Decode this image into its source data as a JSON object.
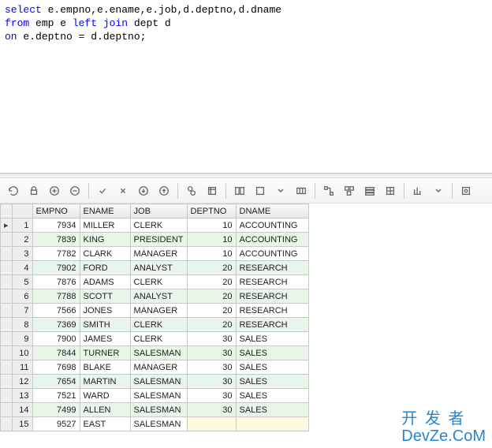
{
  "sql": {
    "line1": {
      "kw1": "select",
      "rest1": " e.empno,e.ename,e.job,d.deptno,d.dname"
    },
    "line2": {
      "kw1": "from",
      "rest1": " emp e ",
      "kw2": "left join",
      "rest2": " dept d"
    },
    "line3": {
      "kw1": "on",
      "rest1": " e.deptno = d.deptno;"
    }
  },
  "toolbar": {
    "icons": [
      "refresh",
      "lock",
      "add",
      "remove",
      "commit",
      "rollback",
      "down-all",
      "up-all",
      "find",
      "filter",
      "group",
      "export-single",
      "filter-rows",
      "fit",
      "relations",
      "diagram",
      "tree",
      "pivot",
      "chart",
      "settings"
    ]
  },
  "grid": {
    "columns": [
      "EMPNO",
      "ENAME",
      "JOB",
      "DEPTNO",
      "DNAME"
    ],
    "rows": [
      {
        "empno": 7934,
        "ename": "MILLER",
        "job": "CLERK",
        "deptno": 10,
        "dname": "ACCOUNTING"
      },
      {
        "empno": 7839,
        "ename": "KING",
        "job": "PRESIDENT",
        "deptno": 10,
        "dname": "ACCOUNTING"
      },
      {
        "empno": 7782,
        "ename": "CLARK",
        "job": "MANAGER",
        "deptno": 10,
        "dname": "ACCOUNTING"
      },
      {
        "empno": 7902,
        "ename": "FORD",
        "job": "ANALYST",
        "deptno": 20,
        "dname": "RESEARCH"
      },
      {
        "empno": 7876,
        "ename": "ADAMS",
        "job": "CLERK",
        "deptno": 20,
        "dname": "RESEARCH"
      },
      {
        "empno": 7788,
        "ename": "SCOTT",
        "job": "ANALYST",
        "deptno": 20,
        "dname": "RESEARCH"
      },
      {
        "empno": 7566,
        "ename": "JONES",
        "job": "MANAGER",
        "deptno": 20,
        "dname": "RESEARCH"
      },
      {
        "empno": 7369,
        "ename": "SMITH",
        "job": "CLERK",
        "deptno": 20,
        "dname": "RESEARCH"
      },
      {
        "empno": 7900,
        "ename": "JAMES",
        "job": "CLERK",
        "deptno": 30,
        "dname": "SALES"
      },
      {
        "empno": 7844,
        "ename": "TURNER",
        "job": "SALESMAN",
        "deptno": 30,
        "dname": "SALES"
      },
      {
        "empno": 7698,
        "ename": "BLAKE",
        "job": "MANAGER",
        "deptno": 30,
        "dname": "SALES"
      },
      {
        "empno": 7654,
        "ename": "MARTIN",
        "job": "SALESMAN",
        "deptno": 30,
        "dname": "SALES"
      },
      {
        "empno": 7521,
        "ename": "WARD",
        "job": "SALESMAN",
        "deptno": 30,
        "dname": "SALES"
      },
      {
        "empno": 7499,
        "ename": "ALLEN",
        "job": "SALESMAN",
        "deptno": 30,
        "dname": "SALES"
      },
      {
        "empno": 9527,
        "ename": "EAST",
        "job": "SALESMAN",
        "deptno": null,
        "dname": null
      }
    ],
    "currentRow": 0
  },
  "watermark": {
    "line1": "开 发 者",
    "line2": "DevZe.CoM"
  }
}
